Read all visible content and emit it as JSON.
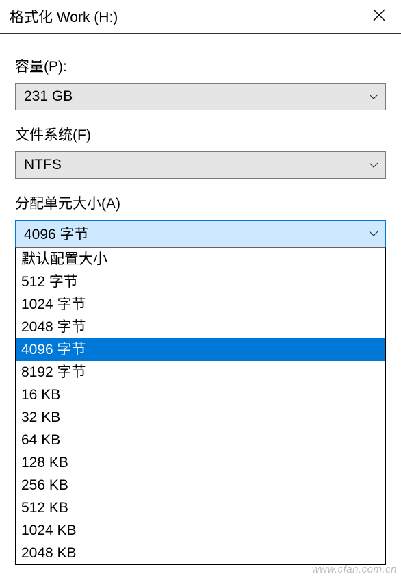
{
  "title": "格式化 Work (H:)",
  "capacity": {
    "label": "容量(P):",
    "value": "231 GB"
  },
  "filesystem": {
    "label": "文件系统(F)",
    "value": "NTFS"
  },
  "allocation": {
    "label": "分配单元大小(A)",
    "value": "4096 字节",
    "options": [
      "默认配置大小",
      "512 字节",
      "1024 字节",
      "2048 字节",
      "4096 字节",
      "8192 字节",
      "16 KB",
      "32 KB",
      "64 KB",
      "128 KB",
      "256 KB",
      "512 KB",
      "1024 KB",
      "2048 KB"
    ],
    "selected_index": 4
  },
  "watermark": "www.cfan.com.cn"
}
